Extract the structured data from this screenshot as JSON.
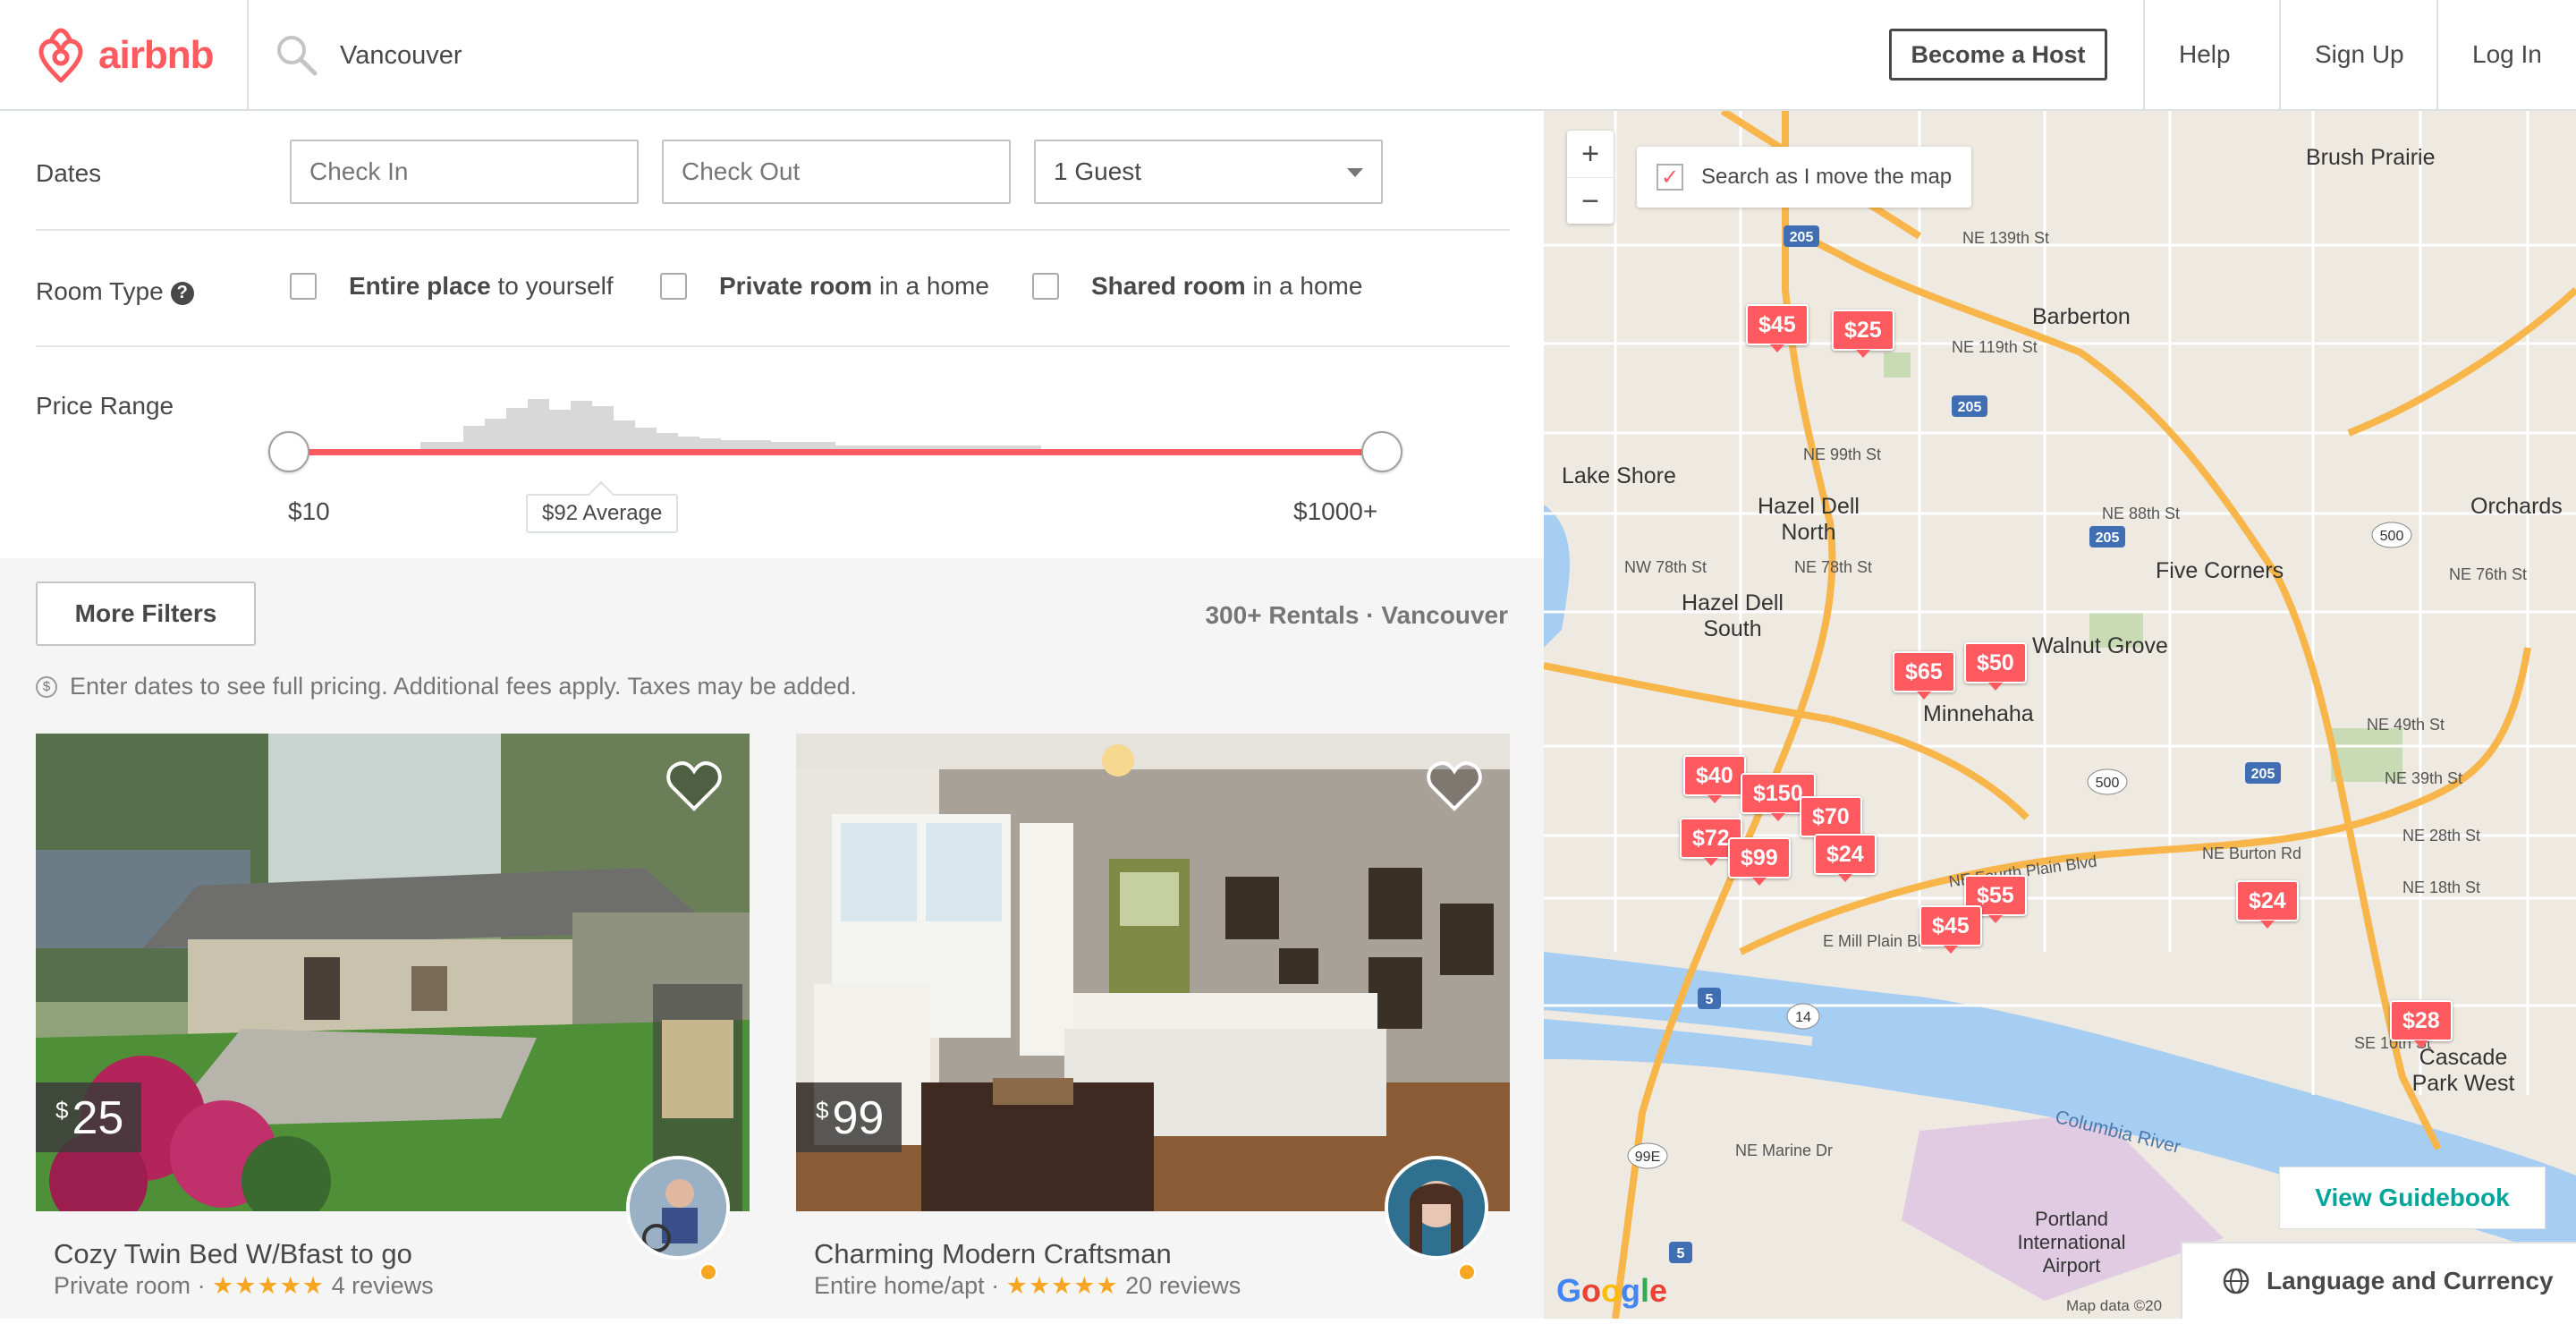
{
  "header": {
    "logo_text": "airbnb",
    "search_value": "Vancouver",
    "become_host": "Become a Host",
    "nav": [
      "Help",
      "Sign Up",
      "Log In"
    ]
  },
  "filters": {
    "dates_label": "Dates",
    "check_in_placeholder": "Check In",
    "check_out_placeholder": "Check Out",
    "guests_value": "1 Guest",
    "room_type_label": "Room Type",
    "room_types": [
      {
        "strong": "Entire place",
        "rest": " to yourself"
      },
      {
        "strong": "Private room",
        "rest": " in a home"
      },
      {
        "strong": "Shared room",
        "rest": " in a home"
      }
    ],
    "price_range_label": "Price Range",
    "price_min": "$10",
    "price_max": "$1000+",
    "average": "$92 Average"
  },
  "results": {
    "more_filters": "More Filters",
    "count": "300+ Rentals · Vancouver",
    "notice": "Enter dates to see full pricing. Additional fees apply. Taxes may be added."
  },
  "listings": [
    {
      "currency": "$",
      "price": "25",
      "title": "Cozy Twin Bed W/Bfast to go",
      "type": "Private room",
      "stars": "★★★★★",
      "reviews": "4 reviews"
    },
    {
      "currency": "$",
      "price": "99",
      "title": "Charming Modern Craftsman",
      "type": "Entire home/apt",
      "stars": "★★★★★",
      "reviews": "20 reviews"
    }
  ],
  "map": {
    "zoom_in": "+",
    "zoom_out": "−",
    "search_move": "Search as I move the map",
    "search_move_checked": true,
    "pins": [
      "$45",
      "$25",
      "$65",
      "$50",
      "$40",
      "$150",
      "$70",
      "$72",
      "$99",
      "$24",
      "$55",
      "$45",
      "$24",
      "$28"
    ],
    "places": [
      "Brush Prairie",
      "Barberton",
      "Lake Shore",
      "Hazel Dell North",
      "Orchards",
      "Five Corners",
      "Hazel Dell South",
      "Walnut Grove",
      "Minnehaha",
      "Cascade Park West",
      "Columbia River",
      "Portland International Airport"
    ],
    "streets": [
      "NE 139th St",
      "NE 119th St",
      "NE 99th St",
      "NE 88th St",
      "NE 78th St",
      "NW 78th St",
      "NE 76th St",
      "NE 49th St",
      "NE 39th St",
      "NE 28th St",
      "NE 18th St",
      "E Mill Plain Blvd",
      "NE Fourth Plain Blvd",
      "NE Burton Rd",
      "SE 10th St",
      "NE Marine Dr"
    ],
    "view_guidebook": "View Guidebook",
    "language_currency": "Language and Currency",
    "google": "Google",
    "map_data": "Map data ©20"
  },
  "colors": {
    "brand": "#ff5a5f",
    "teal": "#00a699",
    "text": "#484848",
    "muted": "#767676"
  }
}
